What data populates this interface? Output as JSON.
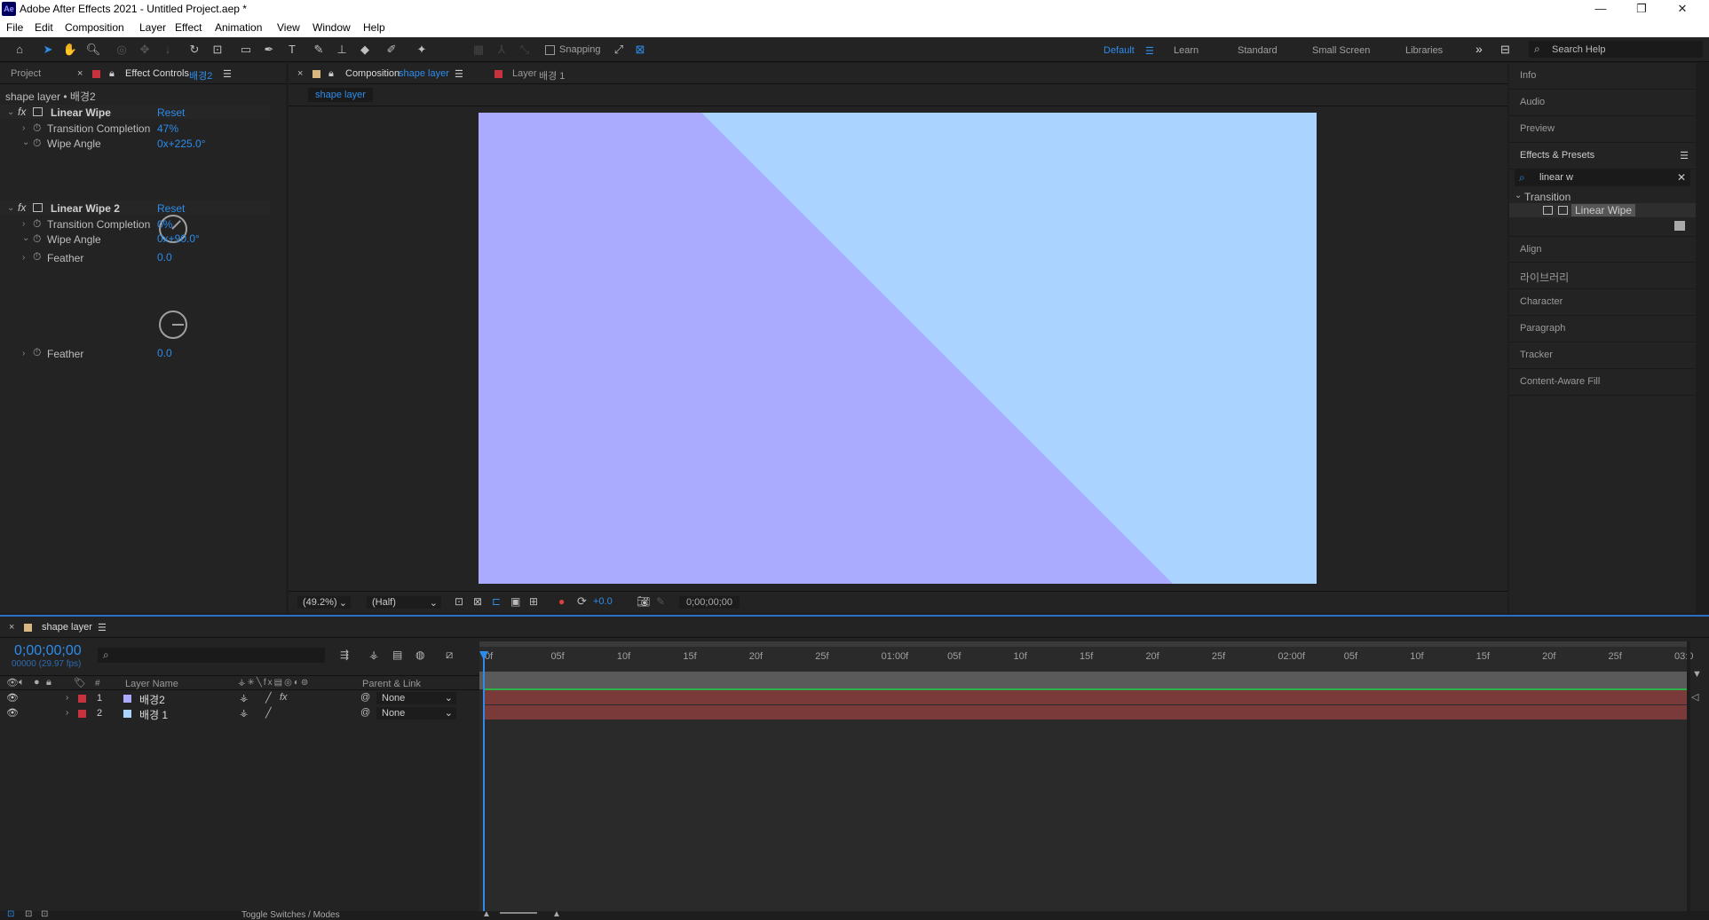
{
  "window": {
    "title": "Adobe After Effects 2021 - Untitled Project.aep *",
    "app_icon": "Ae",
    "minimize": "—",
    "restore": "❐",
    "close": "✕"
  },
  "menu": [
    "File",
    "Edit",
    "Composition",
    "Layer",
    "Effect",
    "Animation",
    "View",
    "Window",
    "Help"
  ],
  "toolbar": {
    "snapping": "Snapping",
    "workspaces": [
      "Default",
      "Learn",
      "Standard",
      "Small Screen",
      "Libraries"
    ],
    "more": "»",
    "search_help": "Search Help"
  },
  "effect_controls": {
    "project_tab": "Project",
    "tab_label": "Effect Controls",
    "tab_layer": "배경2",
    "subtitle": "shape layer • 배경2",
    "effects": [
      {
        "name": "Linear Wipe",
        "reset": "Reset",
        "completion_label": "Transition Completion",
        "completion": "47%",
        "angle_label": "Wipe Angle",
        "angle": "0x+225.0°",
        "feather_label": "Feather",
        "feather": "0.0"
      },
      {
        "name": "Linear Wipe 2",
        "reset": "Reset",
        "completion_label": "Transition Completion",
        "completion": "0%",
        "angle_label": "Wipe Angle",
        "angle": "0x+90.0°",
        "feather_label": "Feather",
        "feather": "0.0"
      }
    ]
  },
  "composition": {
    "tab_label": "Composition",
    "tab_comp": "shape layer",
    "layer_tab": "Layer",
    "layer_tab_name": "배경 1",
    "breadcrumb": "shape layer",
    "colors": {
      "purple": "#aaaaff",
      "blue": "#aad4ff"
    },
    "zoom": "(49.2%)",
    "resolution": "(Half)",
    "exposure": "+0.0",
    "timecode": "0;00;00;00"
  },
  "right_panel": {
    "info": "Info",
    "audio": "Audio",
    "preview": "Preview",
    "effects_presets": "Effects & Presets",
    "search_value": "linear w",
    "category": "Transition",
    "result": "Linear Wipe",
    "align": "Align",
    "libraries": "라이브러리",
    "character": "Character",
    "paragraph": "Paragraph",
    "tracker": "Tracker",
    "content_aware": "Content-Aware Fill"
  },
  "timeline": {
    "tab_label": "shape layer",
    "timecode": "0;00;00;00",
    "frames": "00000 (29.97 fps)",
    "col_num": "#",
    "col_layer_name": "Layer Name",
    "col_parent": "Parent & Link",
    "layers": [
      {
        "num": "1",
        "name": "배경2",
        "parent": "None",
        "fx": "fx",
        "swatch": "#aaaaff"
      },
      {
        "num": "2",
        "name": "배경 1",
        "parent": "None",
        "fx": "",
        "swatch": "#aad4ff"
      }
    ],
    "ruler": [
      "0f",
      "05f",
      "10f",
      "15f",
      "20f",
      "25f",
      "01:00f",
      "05f",
      "10f",
      "15f",
      "20f",
      "25f",
      "02:00f",
      "05f",
      "10f",
      "15f",
      "20f",
      "25f",
      "03:0"
    ],
    "toggle": "Toggle Switches / Modes"
  }
}
